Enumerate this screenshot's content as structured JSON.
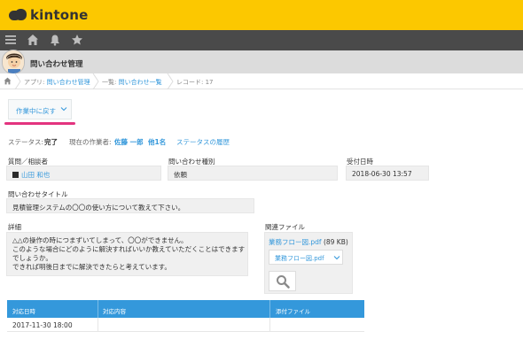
{
  "brand": {
    "name": "kintone"
  },
  "app": {
    "title": "問い合わせ管理"
  },
  "breadcrumb": {
    "app_prefix": "アプリ: ",
    "app_name": "問い合わせ管理",
    "list_prefix": "一覧: ",
    "list_name": "問い合わせ一覧",
    "record": "レコード: 17"
  },
  "status_action": {
    "label": "作業中に戻す"
  },
  "status": {
    "status_key": "ステータス:",
    "status_value": "完了",
    "assignee_key": "現在の作業者:",
    "assignee_1": "佐藤 一郎",
    "assignee_more": "他1名",
    "history_link": "ステータスの履歴"
  },
  "fields": {
    "inquirer_label": "質問／相談者",
    "inquirer_value": "山田 和也",
    "type_label": "問い合わせ種別",
    "type_value": "依頼",
    "received_label": "受付日時",
    "received_value": "2018-06-30 13:57",
    "title_label": "問い合わせタイトル",
    "title_value": "見積管理システムの〇〇の使い方について教えて下さい。",
    "detail_label": "詳細",
    "detail_lines": [
      "△△の操作の時につまずいてしまって、〇〇ができません。",
      "このような場合にどのように解決すればいいか教えていただくことはできます",
      "でしょうか。",
      "できれば明後日までに解決できたらと考えています。"
    ],
    "files_label": "関連ファイル",
    "file_name": "業務フロー図.pdf",
    "file_size": "(89 KB)",
    "file_select": "業務フロー図.pdf"
  },
  "table": {
    "headers": [
      "対応日時",
      "対応内容",
      "添付ファイル"
    ],
    "rows": [
      [
        "2017-11-30 18:00",
        "",
        ""
      ]
    ]
  },
  "colors": {
    "brand_yellow": "#fcc800",
    "nav_dark": "#4a4a4a",
    "link_blue": "#3498db",
    "accent_pink": "#e3337f"
  }
}
